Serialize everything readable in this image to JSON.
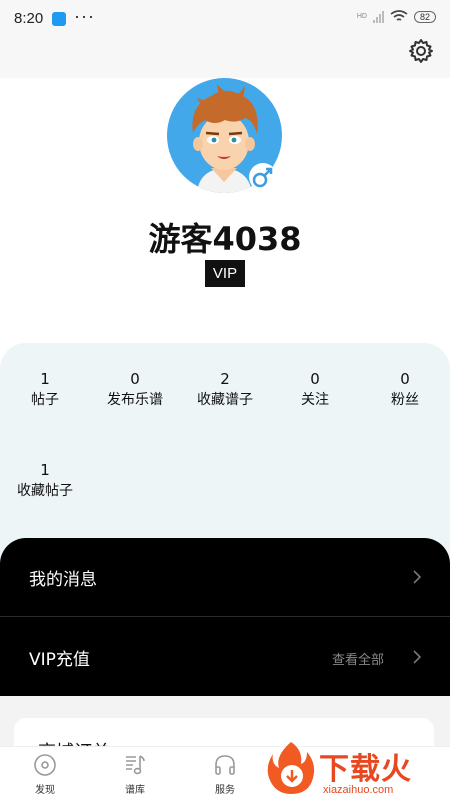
{
  "status_bar": {
    "time": "8:20",
    "dots": "···",
    "network_label": "HD",
    "battery": "82"
  },
  "profile": {
    "username": "游客4038",
    "vip_label": "VIP",
    "gender": "male"
  },
  "stats": [
    {
      "value": "1",
      "label": "帖子"
    },
    {
      "value": "0",
      "label": "发布乐谱"
    },
    {
      "value": "2",
      "label": "收藏谱子"
    },
    {
      "value": "0",
      "label": "关注"
    },
    {
      "value": "0",
      "label": "粉丝"
    },
    {
      "value": "1",
      "label": "收藏帖子"
    }
  ],
  "menu": {
    "messages_label": "我的消息",
    "vip_recharge_label": "VIP充值",
    "view_all_label": "查看全部"
  },
  "card": {
    "title": "商城订单"
  },
  "tabbar": {
    "items": [
      {
        "label": "发现",
        "icon": "disc-icon"
      },
      {
        "label": "谱库",
        "icon": "music-note-icon"
      },
      {
        "label": "服务",
        "icon": "headphones-icon"
      }
    ]
  },
  "watermark": {
    "text": "下载火",
    "url": "xiazaihuo.com"
  },
  "colors": {
    "accent": "#43a8ea",
    "panel": "#eef5f7",
    "menu_bg": "#000000",
    "watermark": "#e84820"
  }
}
